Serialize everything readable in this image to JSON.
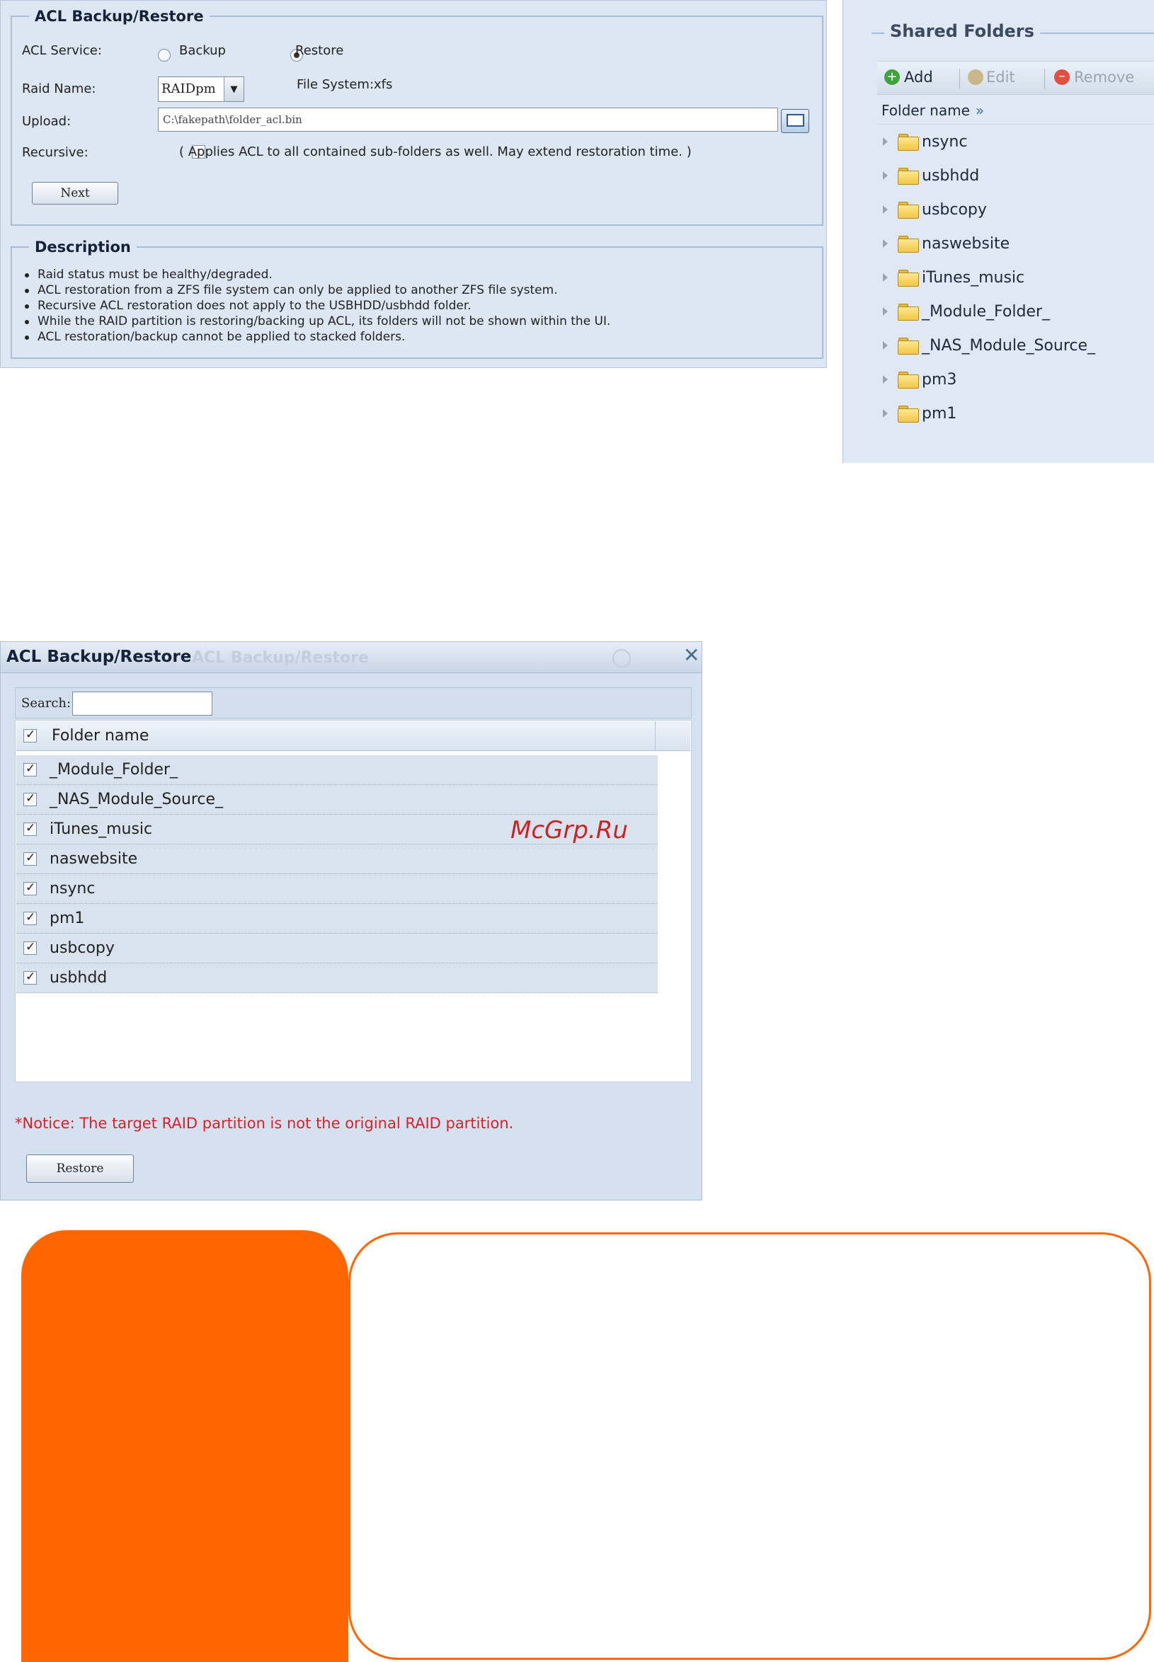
{
  "acl_panel": {
    "legend": "ACL Backup/Restore",
    "service_label": "ACL Service:",
    "option_backup": "Backup",
    "option_restore": "Restore",
    "selected_option": "Restore",
    "raid_label": "Raid Name:",
    "raid_value": "RAIDpm",
    "fs_text": "File System:xfs",
    "upload_label": "Upload:",
    "upload_value": "C:\\fakepath\\folder_acl.bin",
    "recursive_label": "Recursive:",
    "recursive_text": "( Applies ACL to all contained sub-folders as well. May extend restoration time. )",
    "recursive_checked": false,
    "next_label": "Next",
    "description_legend": "Description",
    "description_items": [
      "Raid status must be healthy/degraded.",
      "ACL restoration from a ZFS file system can only be applied to another ZFS file system.",
      "Recursive ACL restoration does not apply to the USBHDD/usbhdd folder.",
      "While the RAID partition is restoring/backing up ACL, its folders will not be shown within the UI.",
      "ACL restoration/backup cannot be applied to stacked folders."
    ]
  },
  "shared_folders": {
    "legend": "Shared Folders",
    "add_label": "Add",
    "edit_label": "Edit",
    "remove_label": "Remove",
    "column_header": "Folder name",
    "column_icon": "double-chevron-right-icon",
    "folders": [
      "nsync",
      "usbhdd",
      "usbcopy",
      "naswebsite",
      "iTunes_music",
      "_Module_Folder_",
      "_NAS_Module_Source_",
      "pm3",
      "pm1"
    ]
  },
  "dialog": {
    "title": "ACL Backup/Restore",
    "ghost_title": "ACL Backup/Restore",
    "close_icon": "close-icon",
    "search_label": "Search:",
    "search_value": "",
    "column_header": "Folder name",
    "rows": [
      "_Module_Folder_",
      "_NAS_Module_Source_",
      "iTunes_music",
      "naswebsite",
      "nsync",
      "pm1",
      "usbcopy",
      "usbhdd"
    ],
    "all_checked": true,
    "notice": "*Notice: The target RAID partition is not the original RAID partition.",
    "restore_label": "Restore"
  },
  "watermark": "McGrp.Ru",
  "colors": {
    "accent_orange": "#ff6600",
    "notice_red": "#d9202a",
    "panel_blue": "#dde7f3",
    "watermark_red": "#cc2222"
  }
}
